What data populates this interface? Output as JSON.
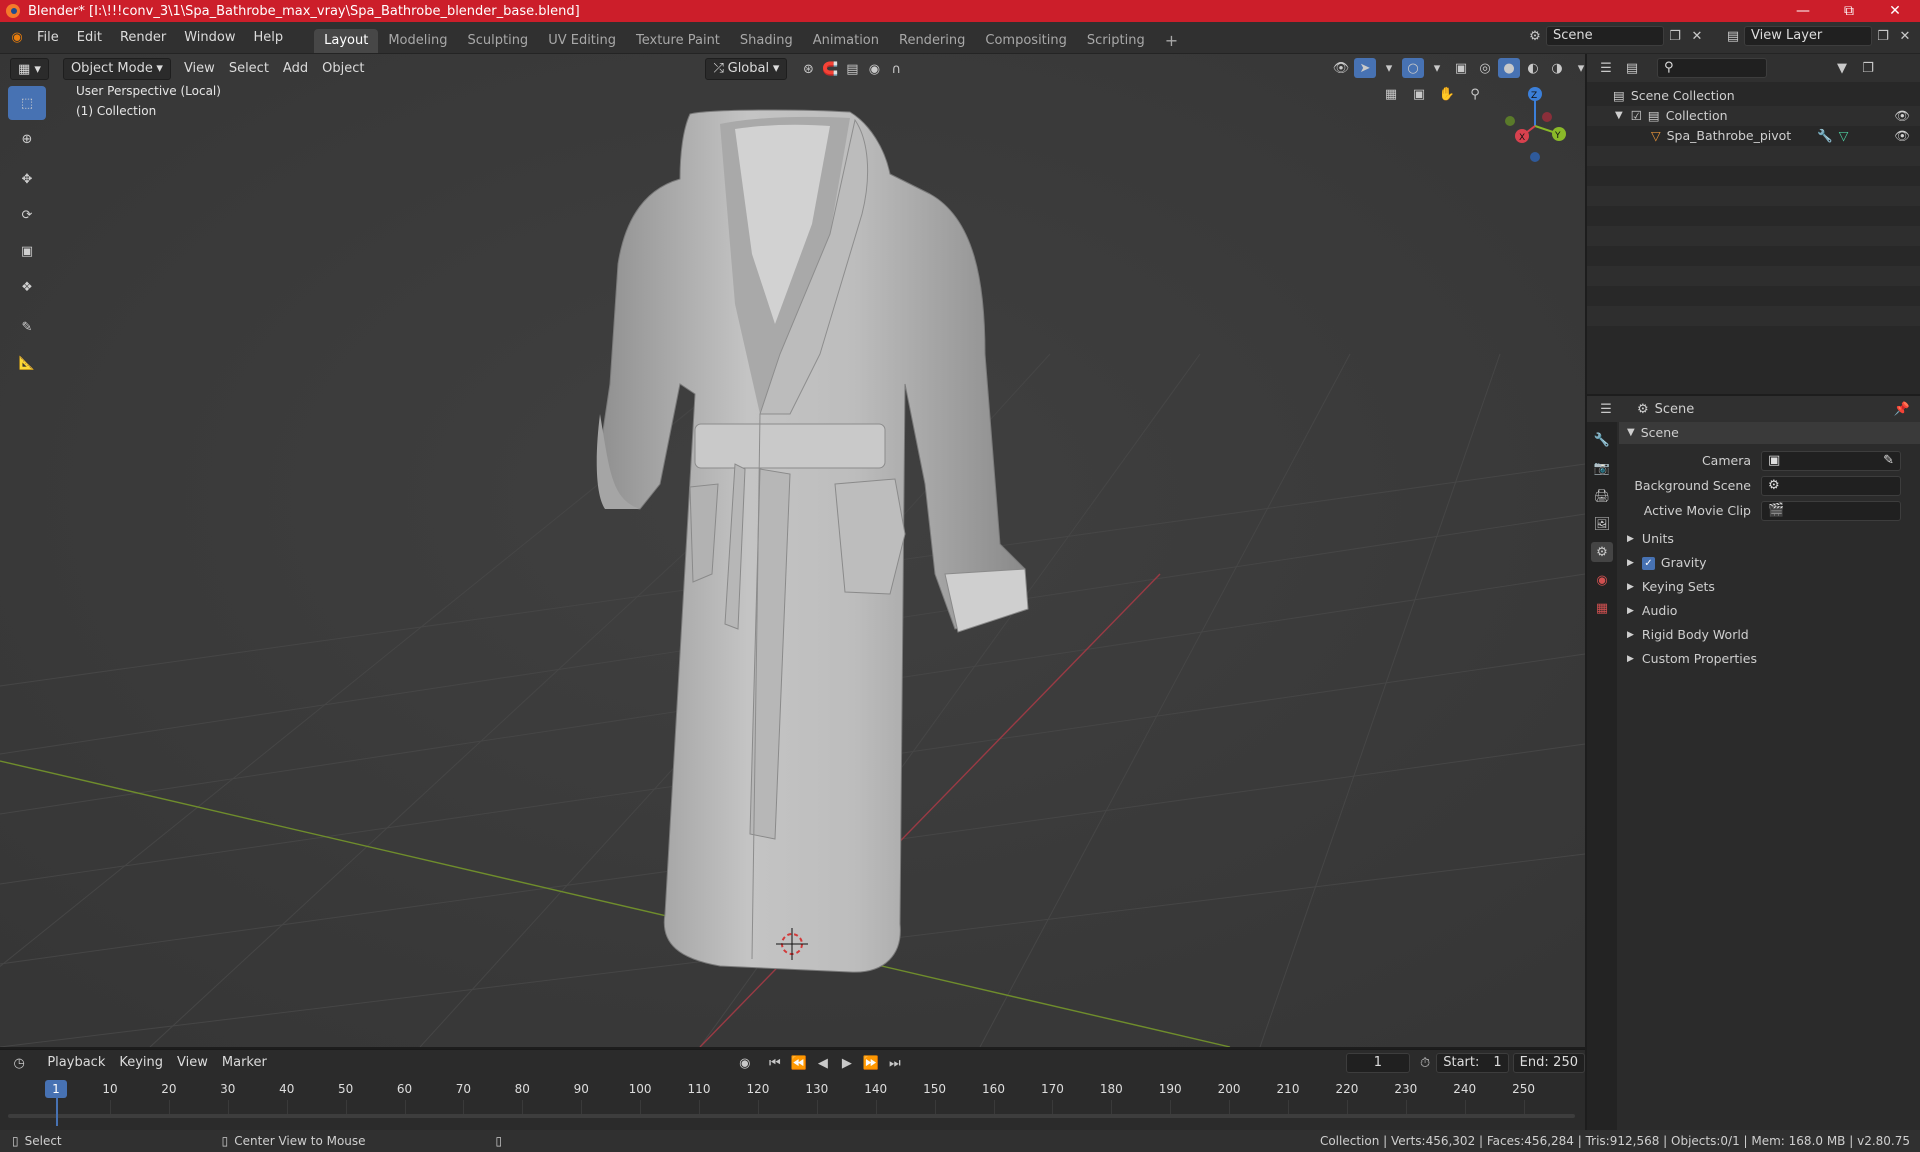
{
  "window": {
    "title": "Blender* [I:\\!!!conv_3\\1\\Spa_Bathrobe_max_vray\\Spa_Bathrobe_blender_base.blend]",
    "controls": [
      "minimize",
      "maximize",
      "close"
    ]
  },
  "menu": [
    "File",
    "Edit",
    "Render",
    "Window",
    "Help"
  ],
  "workspaces": [
    "Layout",
    "Modeling",
    "Sculpting",
    "UV Editing",
    "Texture Paint",
    "Shading",
    "Animation",
    "Rendering",
    "Compositing",
    "Scripting"
  ],
  "active_workspace": "Layout",
  "scene_selector": {
    "value": "Scene"
  },
  "view_layer_selector": {
    "value": "View Layer"
  },
  "viewport_header": {
    "mode": "Object Mode",
    "menus": [
      "View",
      "Select",
      "Add",
      "Object"
    ],
    "orientation": "Global"
  },
  "viewport": {
    "perspective_label": "User Perspective (Local)",
    "collection_label": "(1) Collection",
    "gizmo_axes": {
      "x": "X",
      "y": "Y",
      "z": "Z"
    }
  },
  "outliner": {
    "root": "Scene Collection",
    "collection": "Collection",
    "object": "Spa_Bathrobe_pivot"
  },
  "properties": {
    "context": "Scene",
    "panel_title": "Scene",
    "fields": [
      {
        "label": "Camera",
        "value": ""
      },
      {
        "label": "Background Scene",
        "value": ""
      },
      {
        "label": "Active Movie Clip",
        "value": ""
      }
    ],
    "sections": [
      "Units",
      "Gravity",
      "Keying Sets",
      "Audio",
      "Rigid Body World",
      "Custom Properties"
    ],
    "gravity_checked": true
  },
  "timeline": {
    "menus": [
      "Playback",
      "Keying",
      "View",
      "Marker"
    ],
    "current_frame": "1",
    "start_label": "Start:",
    "start": "1",
    "end_label": "End:",
    "end": "250",
    "ticks": [
      "10",
      "20",
      "30",
      "40",
      "50",
      "60",
      "70",
      "80",
      "90",
      "100",
      "110",
      "120",
      "130",
      "140",
      "150",
      "160",
      "170",
      "180",
      "190",
      "200",
      "210",
      "220",
      "230",
      "240",
      "250"
    ],
    "playhead_label": "1"
  },
  "statusbar": {
    "left_action": "Select",
    "middle_action": "Center View to Mouse",
    "stats": "Collection | Verts:456,302 | Faces:456,284 | Tris:912,568 | Objects:0/1 | Mem: 168.0 MB | v2.80.75"
  },
  "colors": {
    "accent": "#4772b3",
    "titlebar": "#cc1e2a",
    "viewport": "#3b3b3b"
  }
}
